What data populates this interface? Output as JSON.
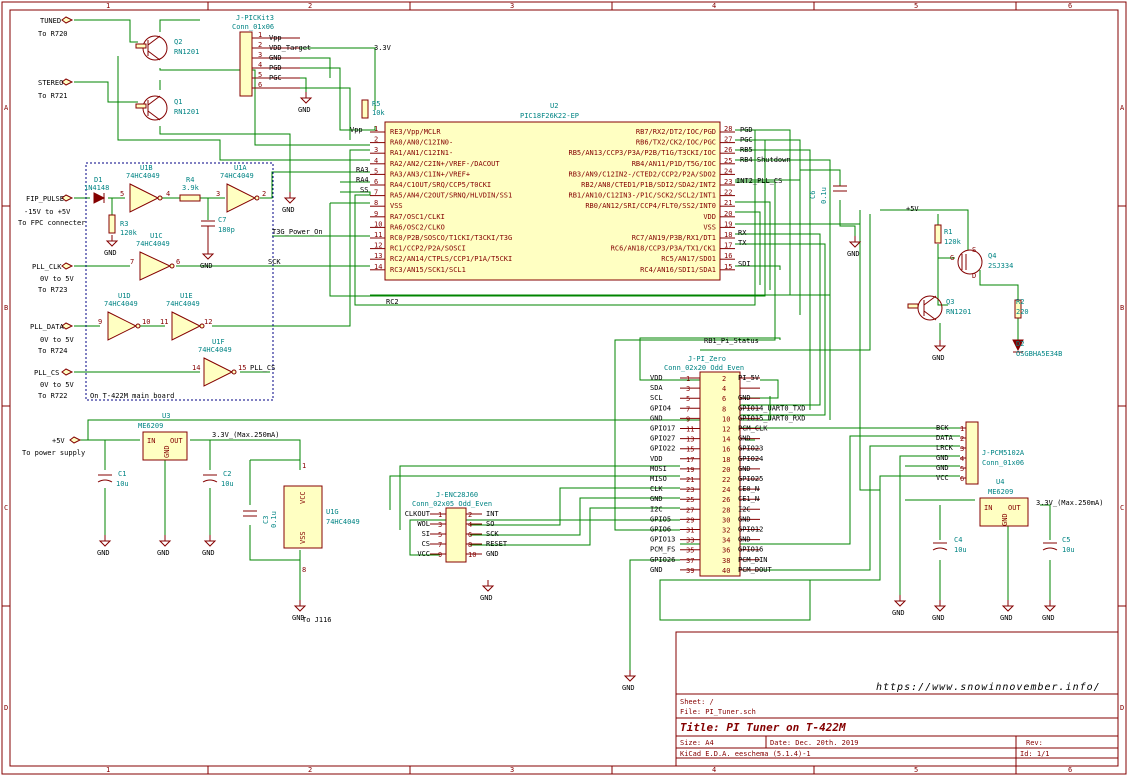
{
  "border": {
    "cols": [
      "1",
      "2",
      "3",
      "4",
      "5",
      "6"
    ],
    "rows": [
      "A",
      "B",
      "C",
      "D"
    ]
  },
  "left_inputs": {
    "tuned": {
      "label": "TUNED",
      "note": "To R720"
    },
    "stereo": {
      "label": "STEREO",
      "note": "To R721"
    },
    "fip_pulse": {
      "label": "FIP_PULSE",
      "note1": "-15V to +5V",
      "note2": "To FPC connecter"
    },
    "pll_clk": {
      "label": "PLL_CLK",
      "note1": "0V to 5V",
      "note2": "To R723"
    },
    "pll_data": {
      "label": "PLL_DATA",
      "note1": "0V to 5V",
      "note2": "To R724"
    },
    "pll_cs": {
      "label": "PLL_CS",
      "note1": "0V to 5V",
      "note2": "To R722"
    },
    "p5v": {
      "label": "+5V",
      "note": "To power supply"
    }
  },
  "components": {
    "q2": {
      "ref": "Q2",
      "val": "RN1201"
    },
    "q1": {
      "ref": "Q1",
      "val": "RN1201"
    },
    "q3": {
      "ref": "Q3",
      "val": "RN1201"
    },
    "q4": {
      "ref": "Q4",
      "val": "2SJ334"
    },
    "d1": {
      "ref": "D1",
      "val": "1N4148"
    },
    "d2": {
      "ref": "D2",
      "val": "OSGBHA5E34B"
    },
    "r1": {
      "ref": "R1",
      "val": "120k"
    },
    "r2": {
      "ref": "R2",
      "val": "220"
    },
    "r3": {
      "ref": "R3",
      "val": "120k"
    },
    "r4": {
      "ref": "R4",
      "val": "3.9k"
    },
    "r5": {
      "ref": "R5",
      "val": "10k"
    },
    "c1": {
      "ref": "C1",
      "val": "10u"
    },
    "c2": {
      "ref": "C2",
      "val": "10u"
    },
    "c3": {
      "ref": "C3",
      "val": "0.1u"
    },
    "c4": {
      "ref": "C4",
      "val": "10u"
    },
    "c5": {
      "ref": "C5",
      "val": "10u"
    },
    "c6": {
      "ref": "C6",
      "val": "0.1u"
    },
    "c7": {
      "ref": "C7",
      "val": "180p"
    },
    "u1a": {
      "ref": "U1A",
      "val": "74HC4049"
    },
    "u1b": {
      "ref": "U1B",
      "val": "74HC4049"
    },
    "u1c": {
      "ref": "U1C",
      "val": "74HC4049"
    },
    "u1d": {
      "ref": "U1D",
      "val": "74HC4049"
    },
    "u1e": {
      "ref": "U1E",
      "val": "74HC4049"
    },
    "u1f": {
      "ref": "U1F",
      "val": "74HC4049"
    },
    "u1g": {
      "ref": "U1G",
      "val": "74HC4049"
    },
    "u3": {
      "ref": "U3",
      "val": "ME6209"
    },
    "u4": {
      "ref": "U4",
      "val": "ME6209"
    },
    "u2": {
      "ref": "U2",
      "val": "PIC18F26K22-EP"
    },
    "jpick": {
      "ref": "J-PICKit3",
      "val": "Conn_01x06"
    },
    "jpi": {
      "ref": "J-PI_Zero",
      "val": "Conn_02x20_Odd_Even"
    },
    "jpcm": {
      "ref": "J-PCM5102A",
      "val": "Conn_01x06"
    },
    "jenc": {
      "ref": "J-ENC28J60",
      "val": "Conn_02x05_Odd_Even"
    }
  },
  "pic_left_pins": [
    {
      "num": "1",
      "name": "RE3/Vpp/MCLR"
    },
    {
      "num": "2",
      "name": "RA0/AN0/C12IN0-"
    },
    {
      "num": "3",
      "name": "RA1/AN1/C12IN1-"
    },
    {
      "num": "4",
      "name": "RA2/AN2/C2IN+/VREF-/DACOUT"
    },
    {
      "num": "5",
      "name": "RA3/AN3/C1IN+/VREF+"
    },
    {
      "num": "6",
      "name": "RA4/C1OUT/SRQ/CCP5/T0CKI"
    },
    {
      "num": "7",
      "name": "RA5/AN4/C2OUT/SRNQ/HLVDIN/SS1"
    },
    {
      "num": "8",
      "name": "VSS"
    },
    {
      "num": "9",
      "name": "RA7/OSC1/CLKI"
    },
    {
      "num": "10",
      "name": "RA6/OSC2/CLKO"
    },
    {
      "num": "11",
      "name": "RC0/P2B/SOSCO/T1CKI/T3CKI/T3G"
    },
    {
      "num": "12",
      "name": "RC1/CCP2/P2A/SOSCI"
    },
    {
      "num": "13",
      "name": "RC2/AN14/CTPLS/CCP1/P1A/T5CKI"
    },
    {
      "num": "14",
      "name": "RC3/AN15/SCK1/SCL1"
    }
  ],
  "pic_right_pins": [
    {
      "num": "28",
      "name": "RB7/RX2/DT2/IOC/PGD"
    },
    {
      "num": "27",
      "name": "RB6/TX2/CK2/IOC/PGC"
    },
    {
      "num": "26",
      "name": "RB5/AN13/CCP3/P3A/P2B/T1G/T3CKI/IOC"
    },
    {
      "num": "25",
      "name": "RB4/AN11/P1D/T5G/IOC"
    },
    {
      "num": "24",
      "name": "RB3/AN9/C12IN2-/CTED2/CCP2/P2A/SDO2"
    },
    {
      "num": "23",
      "name": "RB2/AN8/CTED1/P1B/SDI2/SDA2/INT2"
    },
    {
      "num": "22",
      "name": "RB1/AN10/C12IN3-/P1C/SCK2/SCL2/INT1"
    },
    {
      "num": "21",
      "name": "RB0/AN12/SRI/CCP4/FLT0/SS2/INT0"
    },
    {
      "num": "20",
      "name": "VDD"
    },
    {
      "num": "19",
      "name": "VSS"
    },
    {
      "num": "18",
      "name": "RC7/AN19/P3B/RX1/DT1"
    },
    {
      "num": "17",
      "name": "RC6/AN18/CCP3/P3A/TX1/CK1"
    },
    {
      "num": "16",
      "name": "RC5/AN17/SDO1"
    },
    {
      "num": "15",
      "name": "RC4/AN16/SDI1/SDA1"
    }
  ],
  "pic_nets": {
    "pgd": "PGD",
    "pgc": "PGC",
    "rb5": "RB5",
    "rb4": "RB4 Shutdown",
    "int2": "INT2_PLL_CS",
    "rx": "RX",
    "tx": "TX",
    "sdi": "SDI",
    "ra3": "RA3",
    "ra4": "RA4",
    "ss": "SS",
    "vpp": "Vpp",
    "t3g": "T3G_Power_On",
    "sck": "SCK",
    "rc2": "RC2",
    "rb1": "RB1_Pi_Status",
    "pll_cs": "PLL_CS"
  },
  "pickit_pins": [
    {
      "num": "1",
      "name": "Vpp"
    },
    {
      "num": "2",
      "name": "VDD_Target"
    },
    {
      "num": "3",
      "name": "GND"
    },
    {
      "num": "4",
      "name": "PGD"
    },
    {
      "num": "5",
      "name": "PGC"
    },
    {
      "num": "6",
      "name": ""
    }
  ],
  "pi_pins": [
    {
      "ln": "VDD",
      "l": "1",
      "r": "2",
      "rn": "PI_5V"
    },
    {
      "ln": "SDA",
      "l": "3",
      "r": "4",
      "rn": ""
    },
    {
      "ln": "SCL",
      "l": "5",
      "r": "6",
      "rn": "GND"
    },
    {
      "ln": "GPIO4",
      "l": "7",
      "r": "8",
      "rn": "GPIO14_UART0_TXD"
    },
    {
      "ln": "GND",
      "l": "9",
      "r": "10",
      "rn": "GPIO15_UART0_RXD"
    },
    {
      "ln": "GPIO17",
      "l": "11",
      "r": "12",
      "rn": "PCM_CLK"
    },
    {
      "ln": "GPIO27",
      "l": "13",
      "r": "14",
      "rn": "GND"
    },
    {
      "ln": "GPIO22",
      "l": "15",
      "r": "16",
      "rn": "GPIO23"
    },
    {
      "ln": "VDD",
      "l": "17",
      "r": "18",
      "rn": "GPIO24"
    },
    {
      "ln": "MOSI",
      "l": "19",
      "r": "20",
      "rn": "GND"
    },
    {
      "ln": "MISO",
      "l": "21",
      "r": "22",
      "rn": "GPIO25"
    },
    {
      "ln": "CLK",
      "l": "23",
      "r": "24",
      "rn": "CE0_N"
    },
    {
      "ln": "GND",
      "l": "25",
      "r": "26",
      "rn": "CE1_N"
    },
    {
      "ln": "I2C",
      "l": "27",
      "r": "28",
      "rn": "I2C"
    },
    {
      "ln": "GPIO5",
      "l": "29",
      "r": "30",
      "rn": "GND"
    },
    {
      "ln": "GPIO6",
      "l": "31",
      "r": "32",
      "rn": "GPIO12"
    },
    {
      "ln": "GPIO13",
      "l": "33",
      "r": "34",
      "rn": "GND"
    },
    {
      "ln": "PCM_FS",
      "l": "35",
      "r": "36",
      "rn": "GPIO16"
    },
    {
      "ln": "GPIO26",
      "l": "37",
      "r": "38",
      "rn": "PCM_DIN"
    },
    {
      "ln": "GND",
      "l": "39",
      "r": "40",
      "rn": "PCM_DOUT"
    }
  ],
  "pcm_pins": [
    {
      "num": "1",
      "name": "BCK"
    },
    {
      "num": "2",
      "name": "DATA"
    },
    {
      "num": "3",
      "name": "LRCK"
    },
    {
      "num": "4",
      "name": "GND"
    },
    {
      "num": "5",
      "name": "GND"
    },
    {
      "num": "6",
      "name": "VCC"
    }
  ],
  "enc_pins": [
    {
      "ln": "CLKOUT",
      "l": "1",
      "r": "2",
      "rn": "INT"
    },
    {
      "ln": "WOL",
      "l": "3",
      "r": "4",
      "rn": "SO"
    },
    {
      "ln": "SI",
      "l": "5",
      "r": "6",
      "rn": "SCK"
    },
    {
      "ln": "CS",
      "l": "7",
      "r": "8",
      "rn": "RESET"
    },
    {
      "ln": "VCC",
      "l": "9",
      "r": "10",
      "rn": "GND"
    }
  ],
  "power": {
    "gnd": "GND",
    "v33": "3.3V",
    "p5v": "+5V",
    "v33_max": "3.3V_(Max.250mA)",
    "to_j116": "To J116"
  },
  "reg_pins": {
    "in": "IN",
    "out": "OUT",
    "gnd": "GND"
  },
  "ic_pins": {
    "vcc": "VCC",
    "vss": "VSS"
  },
  "board_note": "On T-422M main board",
  "website": "https://www.snowinnovember.info/",
  "titleblock": {
    "sheet": "Sheet: /",
    "file": "File: PI_Tuner.sch",
    "title": "Title: PI Tuner on T-422M",
    "size": "Size: A4",
    "date": "Date: Dec. 20th. 2019",
    "rev": "Rev:",
    "kicad": "KiCad E.D.A.  eeschema (5.1.4)-1",
    "id": "Id: 1/1"
  },
  "colors": {
    "wire": "#008400",
    "part": "#840000",
    "ref": "#008484",
    "bg": "#ffffff",
    "fill": "#ffffc2"
  }
}
